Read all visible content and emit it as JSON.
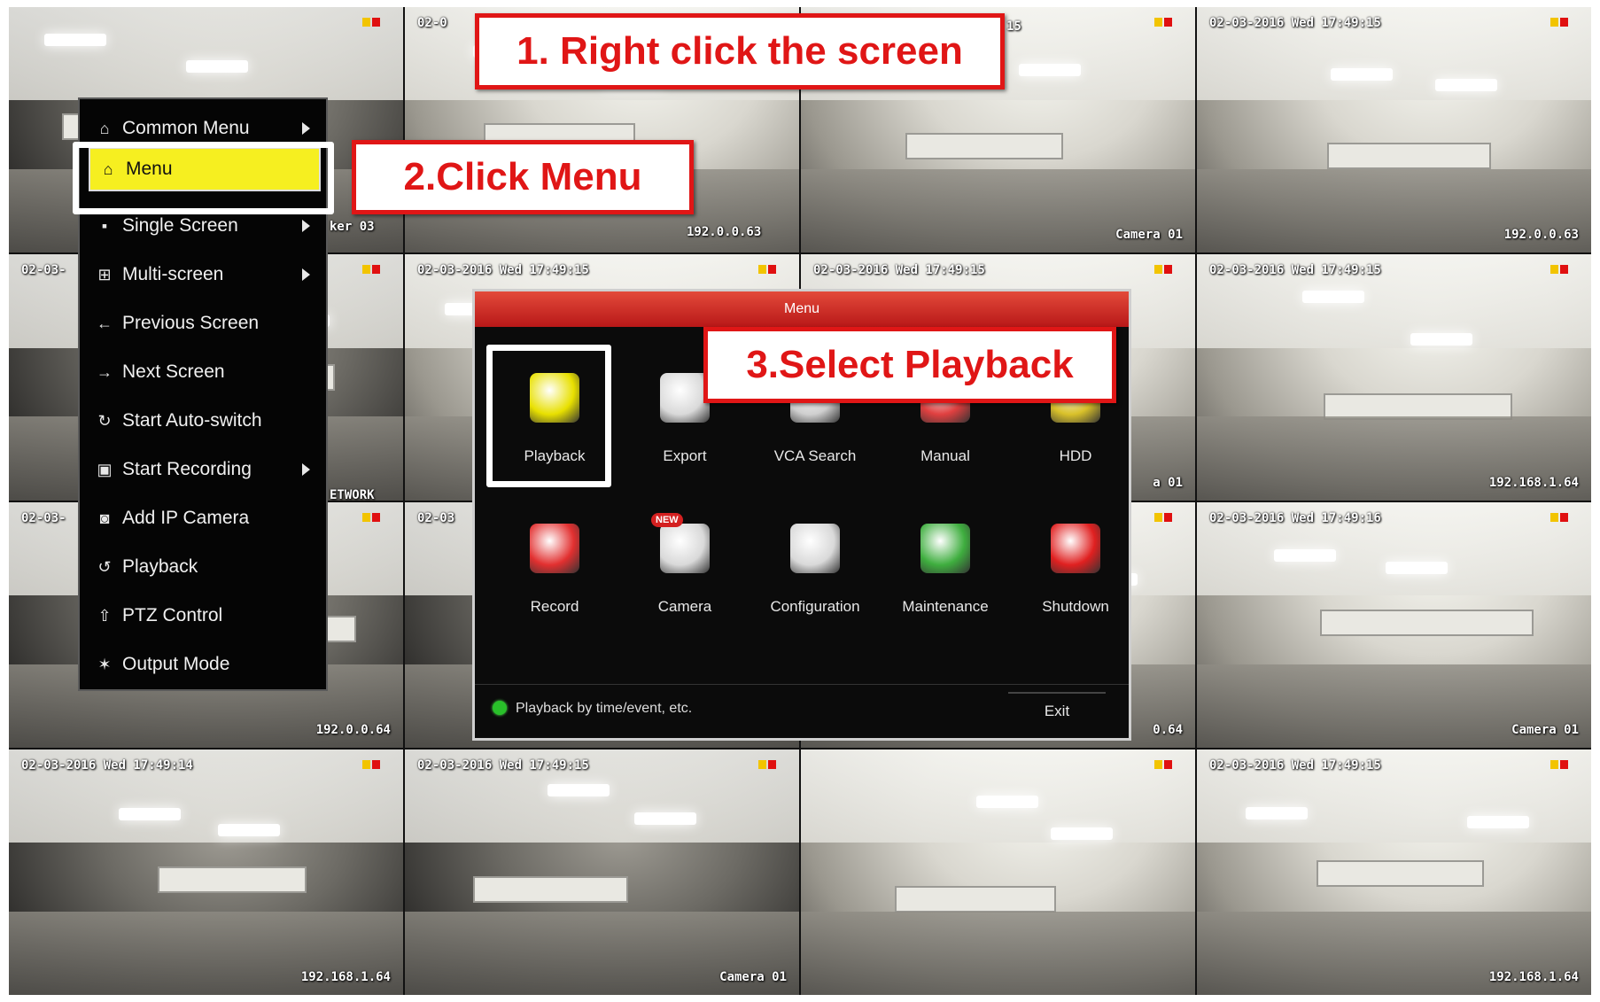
{
  "grid": {
    "tiles": [
      {
        "timestamp": "",
        "label": ""
      },
      {
        "timestamp": "02-0",
        "label": ""
      },
      {
        "timestamp": "",
        "label": "Camera 01"
      },
      {
        "timestamp": "02-03-2016 Wed 17:49:15",
        "label": "192.0.0.63"
      },
      {
        "timestamp": "02-03-",
        "label": ""
      },
      {
        "timestamp": "02-03-2016 Wed 17:49:15",
        "label": ""
      },
      {
        "timestamp": "02-03-2016 Wed 17:49:15",
        "label": "a 01"
      },
      {
        "timestamp": "02-03-2016 Wed 17:49:15",
        "label": "192.168.1.64"
      },
      {
        "timestamp": "02-03-",
        "label": "192.0.0.64"
      },
      {
        "timestamp": "02-03",
        "label": ""
      },
      {
        "timestamp": "",
        "label": "0.64"
      },
      {
        "timestamp": "02-03-2016 Wed 17:49:16",
        "label": "Camera 01"
      },
      {
        "timestamp": "02-03-2016 Wed 17:49:14",
        "label": "192.168.1.64"
      },
      {
        "timestamp": "02-03-2016 Wed 17:49:15",
        "label": "Camera 01"
      },
      {
        "timestamp": "",
        "label": ""
      },
      {
        "timestamp": "02-03-2016 Wed 17:49:15",
        "label": "192.168.1.64"
      }
    ],
    "partial_labels": {
      "p1": "15",
      "p2": "ker 03",
      "p3": "192.0.0.63",
      "p4": "ETWORK"
    }
  },
  "context_menu": {
    "items": [
      {
        "label": "Common Menu",
        "icon": "home-icon",
        "glyph": "⌂",
        "submenu": true
      },
      {
        "label": "Menu",
        "icon": "home-icon",
        "glyph": "⌂",
        "submenu": false,
        "active": true
      },
      {
        "label": "Single Screen",
        "icon": "single-screen-icon",
        "glyph": "▪",
        "submenu": true
      },
      {
        "label": "Multi-screen",
        "icon": "multi-screen-icon",
        "glyph": "⊞",
        "submenu": true
      },
      {
        "label": "Previous Screen",
        "icon": "arrow-left-icon",
        "glyph": "←",
        "submenu": false
      },
      {
        "label": "Next Screen",
        "icon": "arrow-right-icon",
        "glyph": "→",
        "submenu": false
      },
      {
        "label": "Start Auto-switch",
        "icon": "refresh-icon",
        "glyph": "↻",
        "submenu": false
      },
      {
        "label": "Start Recording",
        "icon": "record-icon",
        "glyph": "▣",
        "submenu": true
      },
      {
        "label": "Add IP Camera",
        "icon": "camera-icon",
        "glyph": "◙",
        "submenu": false
      },
      {
        "label": "Playback",
        "icon": "playback-icon",
        "glyph": "↺",
        "submenu": false
      },
      {
        "label": "PTZ Control",
        "icon": "ptz-icon",
        "glyph": "⇧",
        "submenu": false
      },
      {
        "label": "Output Mode",
        "icon": "output-icon",
        "glyph": "✶",
        "submenu": false
      }
    ]
  },
  "dialog": {
    "title": "Menu",
    "tiles": [
      {
        "label": "Playback",
        "icon": "playback-icon",
        "color": "#e8e000"
      },
      {
        "label": "Export",
        "icon": "export-icon",
        "color": "#d9d9d9"
      },
      {
        "label": "VCA Search",
        "icon": "vca-search-icon",
        "color": "#cfcfcf"
      },
      {
        "label": "Manual",
        "icon": "manual-icon",
        "color": "#e04040"
      },
      {
        "label": "HDD",
        "icon": "hdd-icon",
        "color": "#d9c12a"
      },
      {
        "label": "Record",
        "icon": "record-icon",
        "color": "#e23030"
      },
      {
        "label": "Camera",
        "icon": "camera-icon",
        "color": "#d9d9d9",
        "badge": "NEW"
      },
      {
        "label": "Configuration",
        "icon": "configuration-icon",
        "color": "#d9d9d9"
      },
      {
        "label": "Maintenance",
        "icon": "maintenance-icon",
        "color": "#3fae3f"
      },
      {
        "label": "Shutdown",
        "icon": "shutdown-icon",
        "color": "#e02020"
      }
    ],
    "status": "Playback by time/event, etc.",
    "exit_label": "Exit"
  },
  "annotations": {
    "step1": "1. Right click  the screen",
    "step2": "2.Click Menu",
    "step3": "3.Select Playback"
  },
  "colors": {
    "annotation_red": "#e01616",
    "menu_highlight": "#f6ef20",
    "dialog_header": "#c8251f"
  }
}
